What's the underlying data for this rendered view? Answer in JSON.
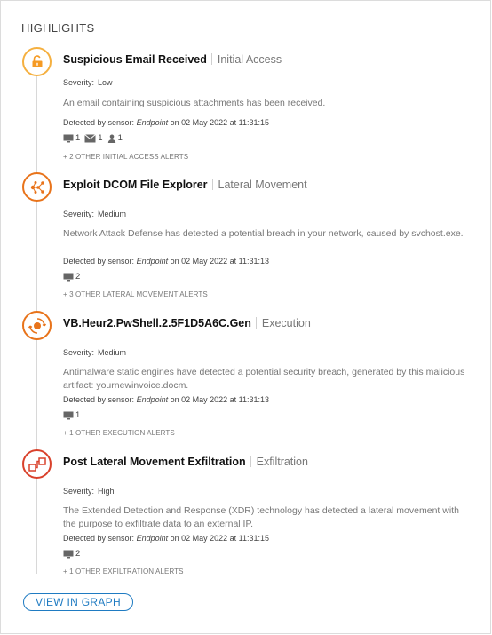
{
  "heading": "HIGHLIGHTS",
  "colors": {
    "orange": "#f59a23",
    "dark_orange": "#e8731a",
    "red": "#d9412b",
    "link_blue": "#1f7bc2"
  },
  "alerts": [
    {
      "icon": "lock-open-icon",
      "title": "Suspicious Email Received",
      "tactic": "Initial Access",
      "severity_label": "Severity:",
      "severity": "Low",
      "description": "An email containing suspicious attachments has been received.",
      "detected_prefix": "Detected by sensor:",
      "sensor": "Endpoint",
      "detected_suffix": "on 02 May 2022 at 11:31:15",
      "counts": {
        "endpoints": "1",
        "emails": "1",
        "users": "1"
      },
      "other_alerts": "+ 2 OTHER INITIAL ACCESS ALERTS"
    },
    {
      "icon": "network-nodes-icon",
      "title": "Exploit DCOM File Explorer",
      "tactic": "Lateral Movement",
      "severity_label": "Severity:",
      "severity": "Medium",
      "description": "Network Attack Defense has detected a potential breach in your network, caused by svchost.exe.",
      "detected_prefix": "Detected by sensor:",
      "sensor": "Endpoint",
      "detected_suffix": "on 02 May 2022 at 11:31:13",
      "counts": {
        "endpoints": "2"
      },
      "other_alerts": "+ 3 OTHER LATERAL MOVEMENT ALERTS"
    },
    {
      "icon": "execution-target-icon",
      "title": "VB.Heur2.PwShell.2.5F1D5A6C.Gen",
      "tactic": "Execution",
      "severity_label": "Severity:",
      "severity": "Medium",
      "description": "Antimalware static engines have detected a potential security breach, generated by this malicious artifact: yournewinvoice.docm.",
      "detected_prefix": "Detected by sensor:",
      "sensor": "Endpoint",
      "detected_suffix": "on 02 May 2022 at 11:31:13",
      "counts": {
        "endpoints": "1"
      },
      "other_alerts": "+ 1 OTHER EXECUTION ALERTS"
    },
    {
      "icon": "exfiltration-icon",
      "title": "Post Lateral Movement Exfiltration",
      "tactic": "Exfiltration",
      "severity_label": "Severity:",
      "severity": "High",
      "description": "The Extended Detection and Response (XDR) technology has detected a lateral movement with the purpose to exfiltrate data to an external IP.",
      "detected_prefix": "Detected by sensor:",
      "sensor": "Endpoint",
      "detected_suffix": "on 02 May 2022 at 11:31:15",
      "counts": {
        "endpoints": "2"
      },
      "other_alerts": "+ 1 OTHER EXFILTRATION ALERTS"
    }
  ],
  "view_graph_label": "VIEW IN GRAPH"
}
